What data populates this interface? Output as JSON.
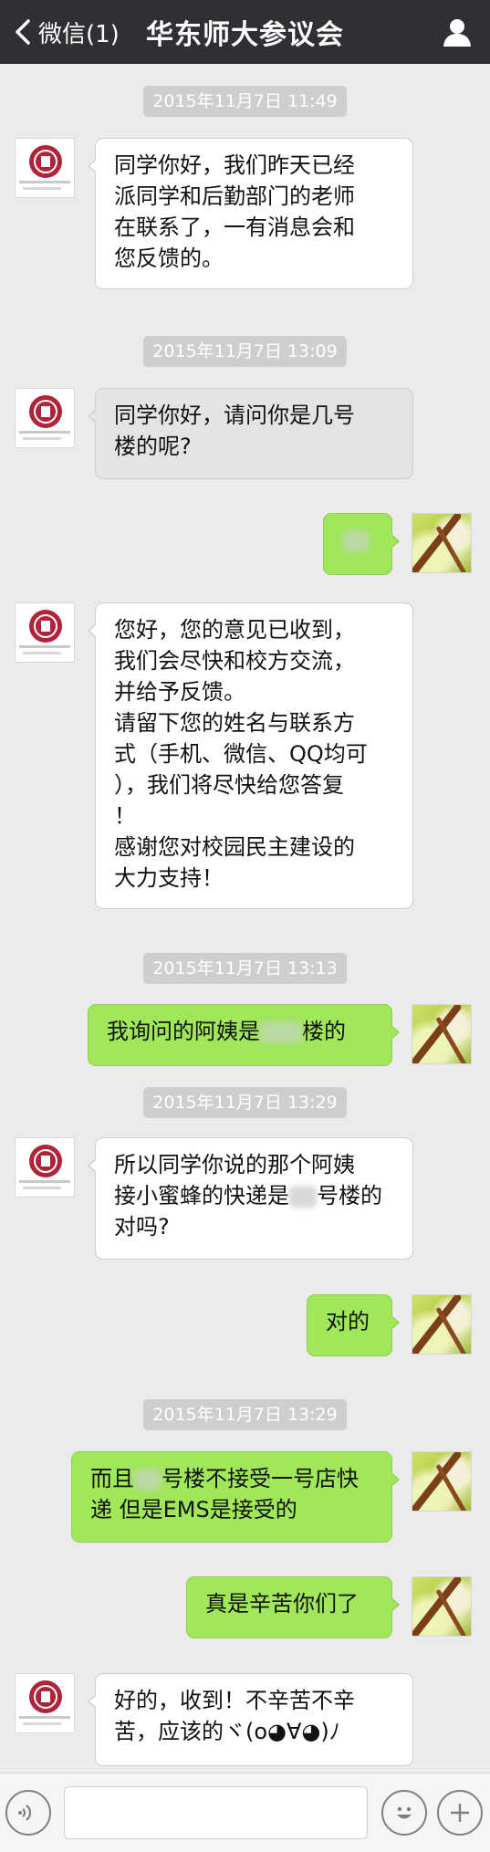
{
  "header": {
    "back_label": "微信(1)",
    "title": "华东师大参议会"
  },
  "messages": [
    {
      "type": "timestamp",
      "text": "2015年11月7日 11:49"
    },
    {
      "type": "message",
      "side": "left",
      "lines": [
        "同学你好，我们昨天已经",
        "派同学和后勤部门的老师",
        "在联系了，一有消息会和",
        "您反馈的。"
      ]
    },
    {
      "type": "timestamp",
      "text": "2015年11月7日 13:09"
    },
    {
      "type": "message",
      "side": "left",
      "lines": [
        "同学你好，请问你是几号",
        "楼的呢?"
      ]
    },
    {
      "type": "message",
      "side": "right",
      "lines": [
        "[redacted]"
      ]
    },
    {
      "type": "message",
      "side": "left",
      "lines": [
        "您好，您的意见已收到，",
        "我们会尽快和校方交流，",
        "并给予反馈。",
        "请留下您的姓名与联系方",
        "式（手机、微信、QQ均可",
        "），我们将尽快给您答复",
        "！",
        "感谢您对校园民主建设的",
        "大力支持！"
      ]
    },
    {
      "type": "timestamp",
      "text": "2015年11月7日 13:13"
    },
    {
      "type": "message",
      "side": "right",
      "parts": [
        "我询问的阿姨是",
        "楼的"
      ]
    },
    {
      "type": "timestamp",
      "text": "2015年11月7日 13:29"
    },
    {
      "type": "message",
      "side": "left",
      "lines": [
        "所以同学你说的那个阿姨",
        "接小蜜蜂的快递是",
        "号楼的",
        "对吗?"
      ]
    },
    {
      "type": "message",
      "side": "right",
      "lines": [
        "对的"
      ]
    },
    {
      "type": "timestamp",
      "text": "2015年11月7日 13:29"
    },
    {
      "type": "message",
      "side": "right",
      "lines": [
        "而且",
        "号楼不接受一号店快",
        "递 但是EMS是接受的"
      ]
    },
    {
      "type": "message",
      "side": "right",
      "lines": [
        "真是辛苦你们了"
      ]
    },
    {
      "type": "message",
      "side": "left",
      "lines": [
        "好的，收到！不辛苦不辛",
        "苦，应该的ヾ(o◕∀◕)ﾉ"
      ]
    }
  ],
  "input_bar": {
    "left_icon": "voice-icon",
    "right_icons": [
      "emoji-icon",
      "plus-icon"
    ]
  },
  "colors": {
    "top_bar": "#2f3033",
    "background": "#ebebeb",
    "outgoing_bubble": "#a0e75a",
    "incoming_bubble": "#ffffff",
    "timestamp_bg": "#cecece"
  }
}
